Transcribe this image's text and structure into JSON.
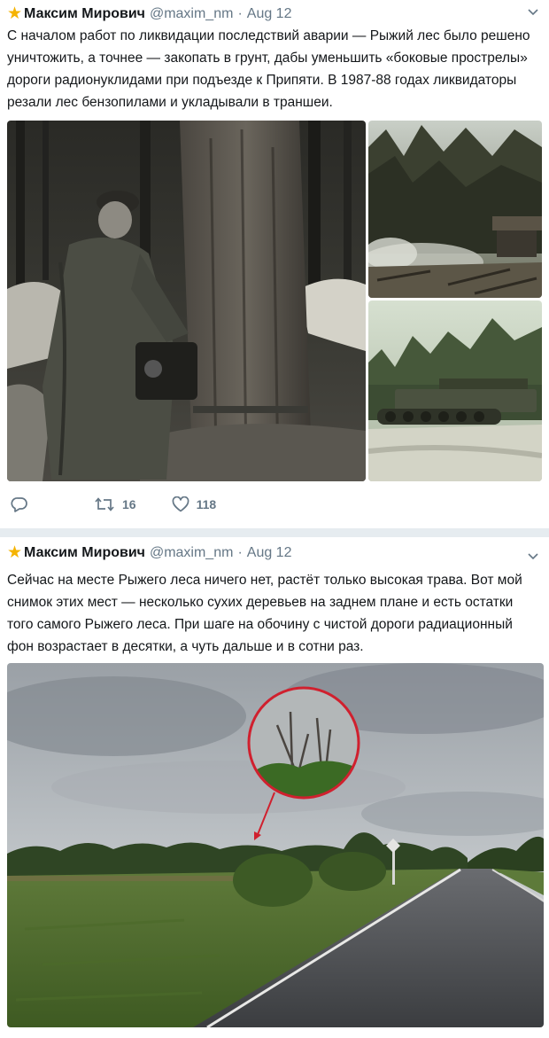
{
  "tweets": [
    {
      "author_name": "Максим Мирович",
      "handle": "@maxim_nm",
      "separator": "·",
      "date": "Aug 12",
      "badge_icon": "star-icon",
      "text": "С началом работ по ликвидации последствий аварии — Рыжий лес было решено уничтожить, а точнее — закопать в грунт, дабы уменьшить «боковые прострелы» дороги радионуклидами при подъезде к Припяти. В 1987-88 годах ликвидаторы резали лес бензопилами и укладывали в траншеи.",
      "actions": {
        "reply_icon": "reply-icon",
        "retweet_icon": "retweet-icon",
        "retweet_count": "16",
        "like_icon": "heart-icon",
        "like_count": "118"
      }
    },
    {
      "author_name": "Максим Мирович",
      "handle": "@maxim_nm",
      "separator": "·",
      "date": "Aug 12",
      "badge_icon": "star-icon",
      "text": "Сейчас на месте Рыжего леса ничего нет, растёт только высокая трава. Вот мой снимок этих мест — несколько сухих деревьев на заднем плане и есть остатки того самого Рыжего леса. При шаге на обочину с чистой дороги радиационный фон возрастает в десятки, а чуть дальше и в сотни раз."
    }
  ],
  "colors": {
    "background": "#e6ecf0",
    "card": "#ffffff",
    "secondary_text": "#657786",
    "star": "#f5b301",
    "annotation_red": "#d0202e"
  }
}
